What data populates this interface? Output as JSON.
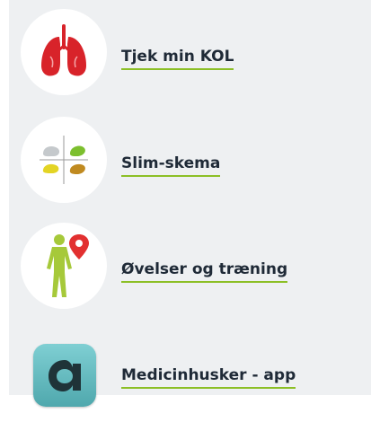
{
  "menu": {
    "items": [
      {
        "label": "Tjek min KOL",
        "icon": "lungs-icon"
      },
      {
        "label": "Slim-skema",
        "icon": "mucus-chart-icon"
      },
      {
        "label": "Øvelser og træning",
        "icon": "body-location-icon"
      },
      {
        "label": "Medicinhusker - app",
        "icon": "app-a-icon"
      }
    ]
  },
  "colors": {
    "panel_bg": "#eef0f2",
    "underline": "#8cbf26",
    "text": "#1f2a37",
    "lungs_red": "#d8232a",
    "figure_green": "#a6c93a",
    "pin_red": "#e23030",
    "app_teal": "#5fb3b8"
  }
}
